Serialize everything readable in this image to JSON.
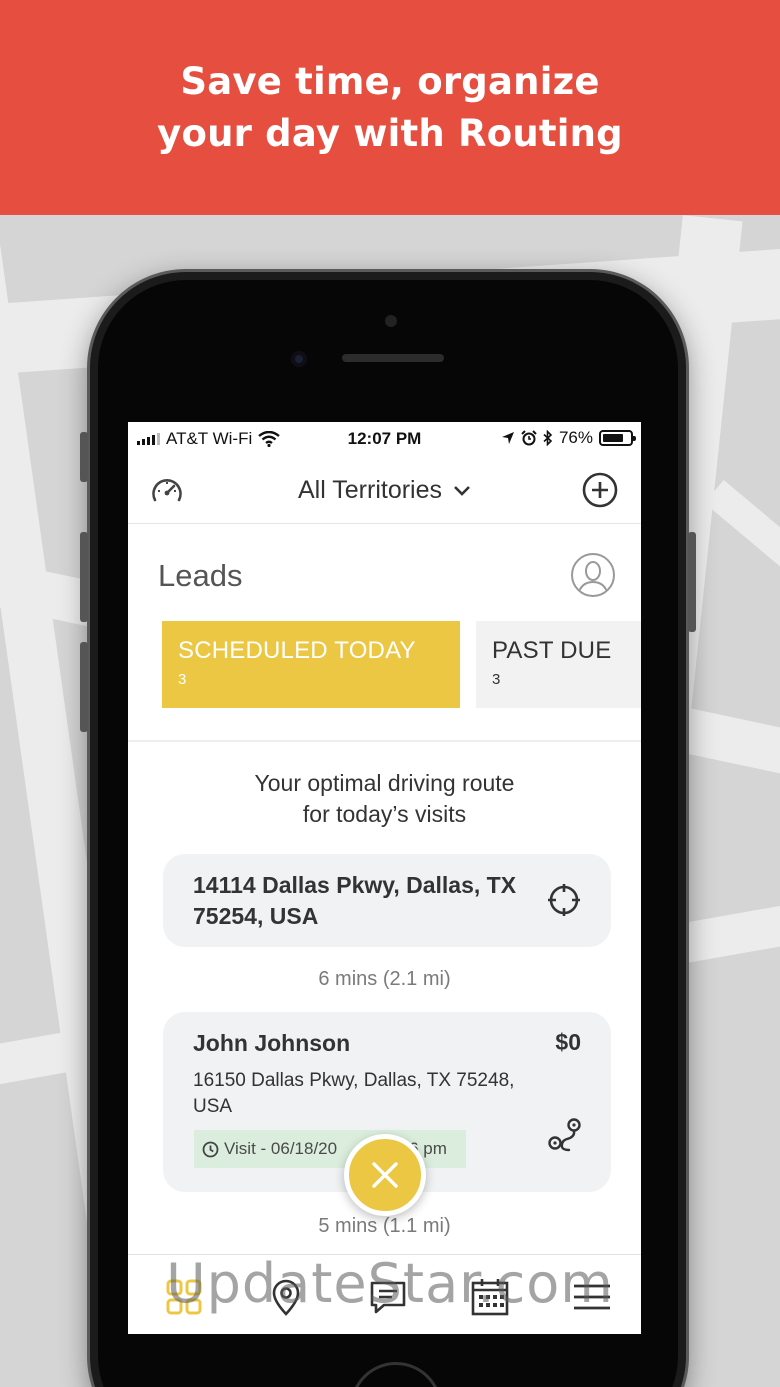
{
  "banner": {
    "line1": "Save time, organize",
    "line2": "your day with Routing",
    "color": "#e64f3f"
  },
  "status_bar": {
    "carrier": "AT&T Wi-Fi",
    "time": "12:07 PM",
    "battery": "76%",
    "battery_level": 0.76,
    "icons": [
      "signal-icon",
      "wifi-icon",
      "location-arrow-icon",
      "alarm-icon",
      "bluetooth-icon",
      "battery-icon"
    ]
  },
  "nav": {
    "title": "All Territories",
    "left_icon": "speedometer-icon",
    "right_icon": "add-circle-icon"
  },
  "leads": {
    "title": "Leads",
    "tabs": [
      {
        "label": "SCHEDULED TODAY",
        "count": "3",
        "active": true
      },
      {
        "label": "PAST DUE",
        "count": "3",
        "active": false
      }
    ]
  },
  "route": {
    "caption_line1": "Your optimal driving route",
    "caption_line2": "for today’s visits",
    "origin": {
      "address_line1": "14114 Dallas Pkwy, Dallas, TX",
      "address_line2": "75254, USA"
    },
    "legs": [
      "6 mins (2.1 mi)",
      "5 mins (1.1 mi)"
    ],
    "stops": [
      {
        "name": "John Johnson",
        "amount": "$0",
        "address_line1": "16150 Dallas Pkwy, Dallas, TX 75248,",
        "address_line2": "USA",
        "visit": "Visit - 06/18/20",
        "visit_tail": "6 pm"
      }
    ]
  },
  "tabbar": {
    "items": [
      "dashboard-grid-icon",
      "map-pin-icon",
      "chat-icon",
      "calendar-icon",
      "menu-icon"
    ]
  },
  "watermark": "UpdateStar.com",
  "colors": {
    "accent_yellow": "#ebc744",
    "visit_badge_green": "#dbeedd",
    "card_gray": "#f1f2f3"
  }
}
